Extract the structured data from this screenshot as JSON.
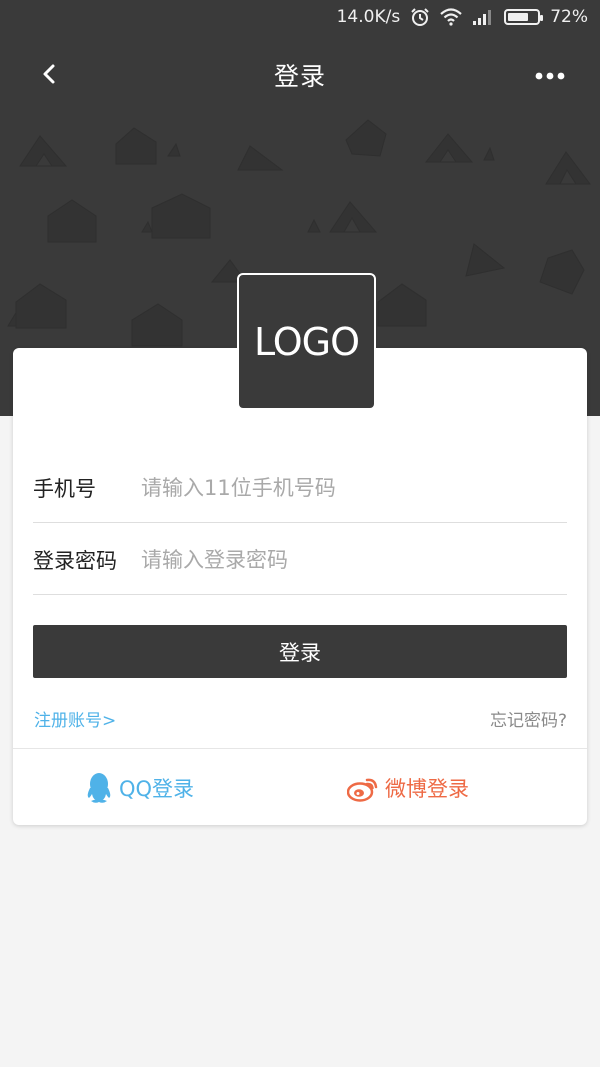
{
  "status_bar": {
    "speed": "14.0K/s",
    "battery_percent": "72%",
    "battery_level": 0.72,
    "icons": [
      "alarm-icon",
      "wifi-icon",
      "signal-icon",
      "battery-icon"
    ]
  },
  "navbar": {
    "title": "登录",
    "back_icon": "back-chevron-icon",
    "more_icon": "more-dots-icon"
  },
  "logo": {
    "text": "LOGO"
  },
  "form": {
    "phone": {
      "label": "手机号",
      "placeholder": "请输入11位手机号码",
      "value": ""
    },
    "password": {
      "label": "登录密码",
      "placeholder": "请输入登录密码",
      "value": ""
    },
    "submit_label": "登录"
  },
  "links": {
    "register": "注册账号>",
    "forgot": "忘记密码?"
  },
  "social": {
    "qq_label": "QQ登录",
    "weibo_label": "微博登录"
  },
  "colors": {
    "header_bg": "#3a3a3a",
    "accent_blue": "#4fb2e8",
    "weibo_orange": "#ee6a45",
    "page_bg": "#f4f4f4"
  }
}
